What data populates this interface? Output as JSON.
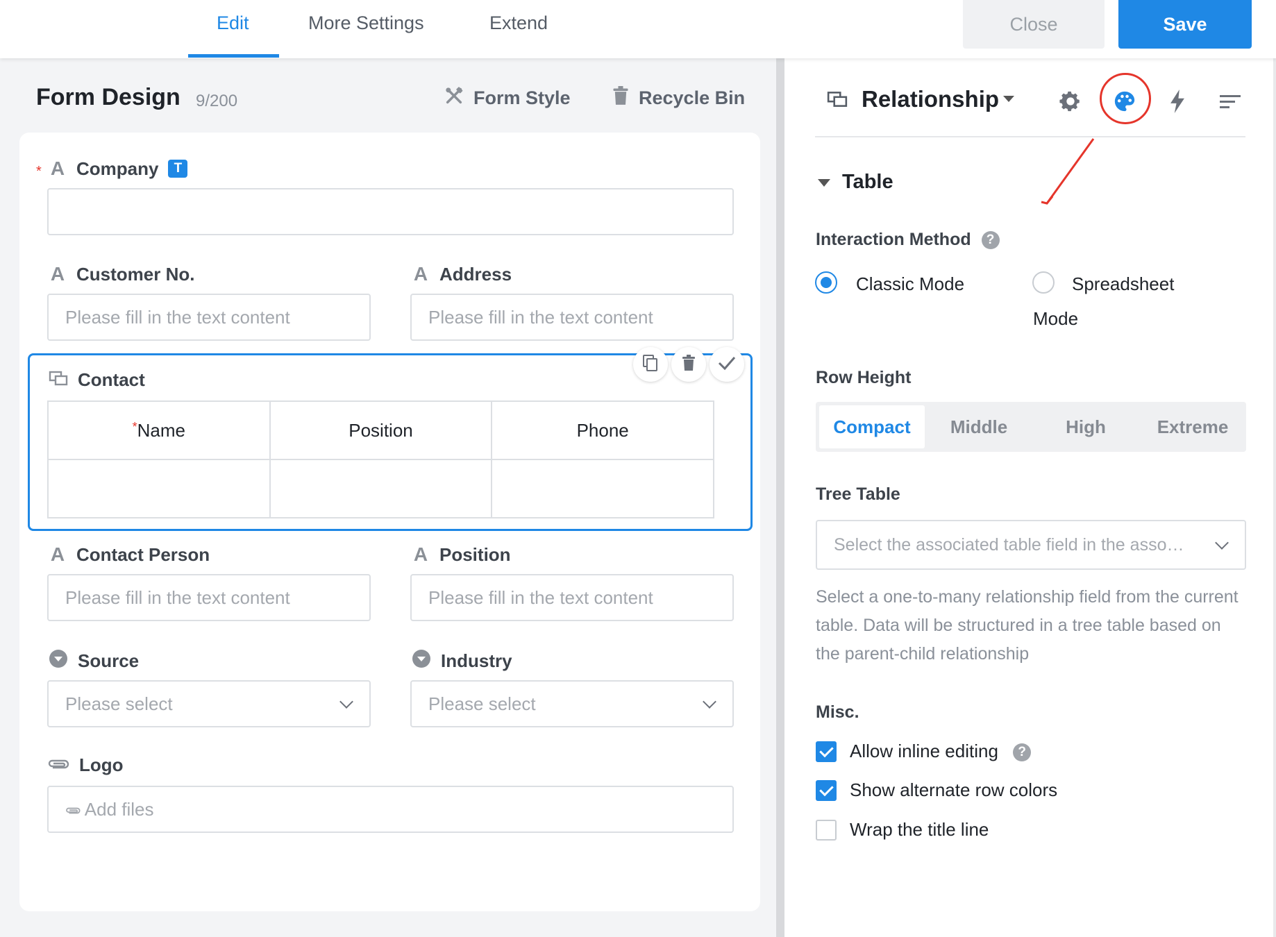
{
  "top_tabs": [
    {
      "label": "Edit",
      "active": true
    },
    {
      "label": "More Settings",
      "active": false
    },
    {
      "label": "Extend",
      "active": false
    }
  ],
  "buttons": {
    "close": "Close",
    "save": "Save"
  },
  "colors": {
    "accent": "#1f88e5",
    "highlight_circle": "#e5352b",
    "required": "#e5352b"
  },
  "form": {
    "title": "Form Design",
    "count": "9/200",
    "form_style": "Form Style",
    "recycle_bin": "Recycle Bin"
  },
  "fields": {
    "company": {
      "label": "Company",
      "badge": "T",
      "required": true,
      "value": ""
    },
    "customer_no": {
      "label": "Customer No.",
      "placeholder": "Please fill in the text content"
    },
    "address": {
      "label": "Address",
      "placeholder": "Please fill in the text content"
    },
    "contact": {
      "label": "Contact",
      "columns": [
        {
          "label": "Name",
          "required": true
        },
        {
          "label": "Position",
          "required": false
        },
        {
          "label": "Phone",
          "required": false
        }
      ]
    },
    "contact_person": {
      "label": "Contact Person",
      "placeholder": "Please fill in the text content"
    },
    "position": {
      "label": "Position",
      "placeholder": "Please fill in the text content"
    },
    "source": {
      "label": "Source",
      "placeholder": "Please select"
    },
    "industry": {
      "label": "Industry",
      "placeholder": "Please select"
    },
    "logo": {
      "label": "Logo",
      "placeholder": "Add files"
    }
  },
  "panel": {
    "title": "Relationship",
    "tool_icons": [
      "gear-icon",
      "palette-icon",
      "lightning-icon",
      "sort-lines-icon"
    ],
    "section": "Table",
    "interaction": {
      "label": "Interaction Method",
      "help": "?",
      "options": [
        {
          "label": "Classic Mode",
          "selected": true
        },
        {
          "label_line1": "Spreadsheet",
          "label_line2": "Mode",
          "selected": false
        }
      ]
    },
    "row_height": {
      "label": "Row Height",
      "options": [
        "Compact",
        "Middle",
        "High",
        "Extreme"
      ],
      "selected": "Compact"
    },
    "tree_table": {
      "label": "Tree Table",
      "placeholder": "Select the associated table field in the asso…",
      "description": "Select a one-to-many relationship field from the current table. Data will be structured in a tree table based on the parent-child relationship"
    },
    "misc": {
      "label": "Misc.",
      "options": [
        {
          "label": "Allow inline editing",
          "checked": true,
          "help": "?"
        },
        {
          "label": "Show alternate row colors",
          "checked": true
        },
        {
          "label": "Wrap the title line",
          "checked": false
        }
      ]
    }
  }
}
